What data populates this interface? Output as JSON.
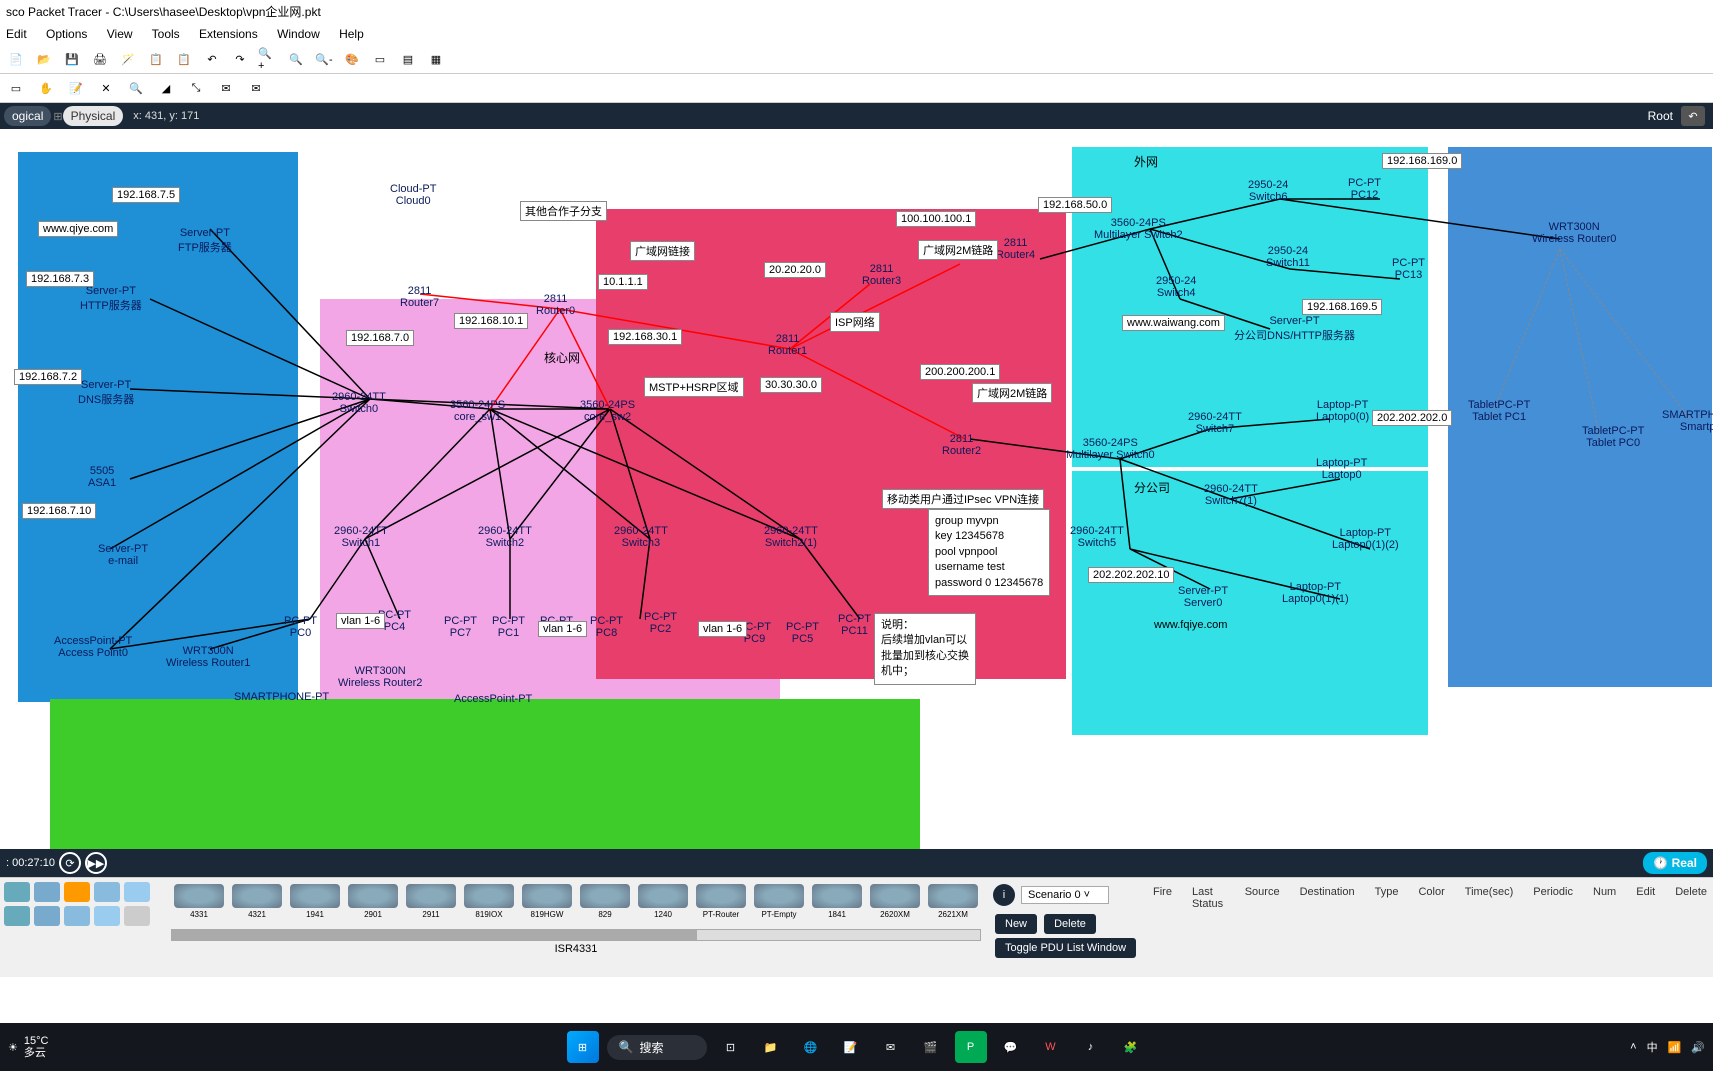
{
  "window": {
    "title": "sco Packet Tracer - C:\\Users\\hasee\\Desktop\\vpn企业网.pkt"
  },
  "menu": [
    "Edit",
    "Options",
    "View",
    "Tools",
    "Extensions",
    "Window",
    "Help"
  ],
  "workspace": {
    "logical": "ogical",
    "physical": "Physical",
    "coords": "x: 431, y: 171",
    "root": "Root"
  },
  "clusters": {
    "waiwang_title": "外网",
    "fengongsi_title": "分公司",
    "core_title": "核心网",
    "wan_area": "广域网链接",
    "isp": "ISP网络",
    "mstp": "MSTP+HSRP区域",
    "hezuo": "其他合作子分支",
    "wan2m_a": "广域网2M链路",
    "wan2m_b": "广域网2M链路",
    "ipsec_note": "移动类用户通过IPsec VPN连接"
  },
  "ips": {
    "a1": "192.168.7.5",
    "a2": "www.qiye.com",
    "a3": "192.168.7.3",
    "a4": "192.168.7.2",
    "a5": "192.168.7.10",
    "a6": "192.168.7.0",
    "b1": "192.168.10.1",
    "b2": "10.1.1.1",
    "b3": "192.168.30.1",
    "c1": "20.20.20.0",
    "c2": "30.30.30.0",
    "c3": "100.100.100.1",
    "c4": "200.200.200.1",
    "d1": "192.168.50.0",
    "d2": "192.168.169.0",
    "d3": "192.168.169.5",
    "d4": "www.waiwang.com",
    "e1": "202.202.202.0",
    "e2": "202.202.202.10",
    "vlan16a": "vlan 1-6",
    "vlan16b": "vlan 1-6",
    "vlan16c": "vlan 1-6"
  },
  "devices": {
    "ftp": "Server-PT\nFTP服务器",
    "http": "Server-PT\nHTTP服务器",
    "dns": "Server-PT\nDNS服务器",
    "asa": "5505\nASA1",
    "email": "Server-PT\ne-mail",
    "cloud": "Cloud-PT\nCloud0",
    "r7": "2811\nRouter7",
    "r0": "2811\nRouter0",
    "r1": "2811\nRouter1",
    "r2": "2811\nRouter2",
    "r3": "2811\nRouter3",
    "r4": "2811\nRouter4",
    "sw0": "2960-24TT\nSwitch0",
    "core1": "3560-24PS\ncore_sw1",
    "core2": "3560-24PS\ncore_sw2",
    "sw1": "2960-24TT\nSwitch1",
    "sw2": "2960-24TT\nSwitch2",
    "sw3": "2960-24TT\nSwitch3",
    "sw21": "2960-24TT\nSwitch2(1)",
    "ap0": "AccessPoint-PT\nAccess Point0",
    "wrt1": "WRT300N\nWireless Router1",
    "wrt2": "WRT300N\nWireless Router2",
    "smart": "SMARTPHONE-PT",
    "ap1": "AccessPoint-PT",
    "pc0": "PC-PT\nPC0",
    "pc4": "PC-PT\nPC4",
    "pc7": "PC-PT\nPC7",
    "pc1": "PC-PT\nPC1",
    "pc6": "PC-PT\nPC6",
    "pc8": "PC-PT\nPC8",
    "pc2": "PC-PT\nPC2",
    "pc9": "PC-PT\nPC9",
    "pc5": "PC-PT\nPC5",
    "pc11": "PC-PT\nPC11",
    "ml2": "3560-24PS\nMultilayer Switch2",
    "sw4": "2950-24\nSwitch4",
    "sw6": "2950-24\nSwitch6",
    "sw11": "2950-24\nSwitch11",
    "pc12": "PC-PT\nPC12",
    "pc13": "PC-PT\nPC13",
    "servdns": "Server-PT\n分公司DNS/HTTP服务器",
    "ml0": "3560-24PS\nMultilayer Switch0",
    "sw5": "2960-24TT\nSwitch5",
    "sw7a": "2960-24TT\nSwitch7",
    "sw71": "2960-24TT\nSwitch7(1)",
    "lp00": "Laptop-PT\nLaptop0(0)",
    "lp0": "Laptop-PT\nLaptop0",
    "lp012": "Laptop-PT\nLaptop0(1)(2)",
    "lp011": "Laptop-PT\nLaptop0(1)(1)",
    "serv0": "Server-PT\nServer0",
    "fqiye": "www.fqiye.com",
    "wrt0": "WRT300N\nWireless Router0",
    "tpc1": "TabletPC-PT\nTablet PC1",
    "tpc0": "TabletPC-PT\nTablet PC0",
    "smph": "SMARTPHONE\nSmartph"
  },
  "vpn_note": "group myvpn\nkey 12345678\npool vpnpool\nusername test\npassword 0 12345678",
  "desc_note": "说明：\n后续增加vlan可以\n批量加到核心交换\n机中；",
  "timebar": {
    "time": ": 00:27:10"
  },
  "realtime": "Real",
  "models": [
    "4331",
    "4321",
    "1941",
    "2901",
    "2911",
    "819IOX",
    "819HGW",
    "829",
    "1240",
    "PT-Router",
    "PT-Empty",
    "1841",
    "2620XM",
    "2621XM"
  ],
  "selected_model": "ISR4331",
  "scenario": {
    "label": "Scenario 0",
    "new": "New",
    "delete": "Delete",
    "toggle": "Toggle PDU List Window"
  },
  "pdu_cols": [
    "Fire",
    "Last Status",
    "Source",
    "Destination",
    "Type",
    "Color",
    "Time(sec)",
    "Periodic",
    "Num",
    "Edit",
    "Delete"
  ],
  "taskbar": {
    "temp": "15°C",
    "cond": "多云",
    "search": "搜索",
    "ime": "中"
  }
}
